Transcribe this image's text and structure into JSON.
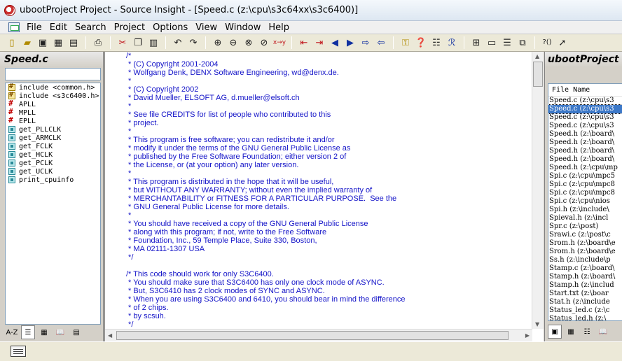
{
  "window": {
    "title": "ubootProject Project - Source Insight - [Speed.c (z:\\cpu\\s3c64xx\\s3c6400)]"
  },
  "menu": [
    "File",
    "Edit",
    "Search",
    "Project",
    "Options",
    "View",
    "Window",
    "Help"
  ],
  "symbol_panel": {
    "title": "Speed.c",
    "filter_value": "",
    "symbols": [
      {
        "icon": "include-icon",
        "label": "include <common.h>"
      },
      {
        "icon": "include-icon",
        "label": "include <s3c6400.h>"
      },
      {
        "icon": "define-icon",
        "label": "APLL"
      },
      {
        "icon": "define-icon",
        "label": "MPLL"
      },
      {
        "icon": "define-icon",
        "label": "EPLL"
      },
      {
        "icon": "function-icon",
        "label": "get_PLLCLK"
      },
      {
        "icon": "function-icon",
        "label": "get_ARMCLK"
      },
      {
        "icon": "function-icon",
        "label": "get_FCLK"
      },
      {
        "icon": "function-icon",
        "label": "get_HCLK"
      },
      {
        "icon": "function-icon",
        "label": "get_PCLK"
      },
      {
        "icon": "function-icon",
        "label": "get_UCLK"
      },
      {
        "icon": "function-icon",
        "label": "print_cpuinfo"
      }
    ],
    "tab_sort": "A-Z"
  },
  "editor": {
    "lines": [
      "/*",
      " * (C) Copyright 2001-2004",
      " * Wolfgang Denk, DENX Software Engineering, wd@denx.de.",
      " *",
      " * (C) Copyright 2002",
      " * David Mueller, ELSOFT AG, d.mueller@elsoft.ch",
      " *",
      " * See file CREDITS for list of people who contributed to this",
      " * project.",
      " *",
      " * This program is free software; you can redistribute it and/or",
      " * modify it under the terms of the GNU General Public License as",
      " * published by the Free Software Foundation; either version 2 of",
      " * the License, or (at your option) any later version.",
      " *",
      " * This program is distributed in the hope that it will be useful,",
      " * but WITHOUT ANY WARRANTY; without even the implied warranty of",
      " * MERCHANTABILITY or FITNESS FOR A PARTICULAR PURPOSE.  See the",
      " * GNU General Public License for more details.",
      " *",
      " * You should have received a copy of the GNU General Public License",
      " * along with this program; if not, write to the Free Software",
      " * Foundation, Inc., 59 Temple Place, Suite 330, Boston,",
      " * MA 02111-1307 USA",
      " */",
      "",
      "/* This code should work for only S3C6400.",
      " * You should make sure that S3C6400 has only one clock mode of ASYNC.",
      " * But, S3C6410 has 2 clock modes of SYNC and ASYNC.",
      " * When you are using S3C6400 and 6410, you should bear in mind the difference",
      " * of 2 chips.",
      " * by scsuh.",
      " */"
    ]
  },
  "project_panel": {
    "title": "ubootProject F",
    "column_header": "File Name",
    "files": [
      {
        "name": "Speed.c (z:\\cpu\\s3",
        "selected": false
      },
      {
        "name": "Speed.c (z:\\cpu\\s3",
        "selected": true
      },
      {
        "name": "Speed.c (z:\\cpu\\s3",
        "selected": false
      },
      {
        "name": "Speed.c (z:\\cpu\\s3",
        "selected": false
      },
      {
        "name": "Speed.h (z:\\board\\",
        "selected": false
      },
      {
        "name": "Speed.h (z:\\board\\",
        "selected": false
      },
      {
        "name": "Speed.h (z:\\board\\",
        "selected": false
      },
      {
        "name": "Speed.h (z:\\board\\",
        "selected": false
      },
      {
        "name": "Speed.h (z:\\cpu\\mp",
        "selected": false
      },
      {
        "name": "Spi.c (z:\\cpu\\mpc5",
        "selected": false
      },
      {
        "name": "Spi.c (z:\\cpu\\mpc8",
        "selected": false
      },
      {
        "name": "Spi.c (z:\\cpu\\mpc8",
        "selected": false
      },
      {
        "name": "Spi.c (z:\\cpu\\nios",
        "selected": false
      },
      {
        "name": "Spi.h (z:\\include\\",
        "selected": false
      },
      {
        "name": "Spieval.h (z:\\incl",
        "selected": false
      },
      {
        "name": "Spr.c (z:\\post)",
        "selected": false
      },
      {
        "name": "Srawi.c (z:\\post\\c",
        "selected": false
      },
      {
        "name": "Srom.h (z:\\board\\e",
        "selected": false
      },
      {
        "name": "Srom.h (z:\\board\\e",
        "selected": false
      },
      {
        "name": "Ss.h (z:\\include\\p",
        "selected": false
      },
      {
        "name": "Stamp.c (z:\\board\\",
        "selected": false
      },
      {
        "name": "Stamp.h (z:\\board\\",
        "selected": false
      },
      {
        "name": "Stamp.h (z:\\includ",
        "selected": false
      },
      {
        "name": "Start.txt (z:\\boar",
        "selected": false
      },
      {
        "name": "Stat.h (z:\\include",
        "selected": false
      },
      {
        "name": "Status_led.c (z:\\c",
        "selected": false
      },
      {
        "name": "Status_led.h (z:\\",
        "selected": false
      }
    ]
  }
}
